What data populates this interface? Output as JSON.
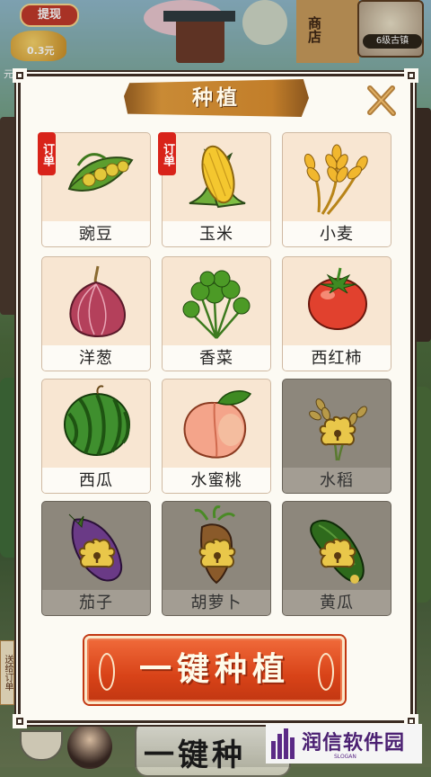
{
  "hud": {
    "withdraw_label": "提现",
    "coin_amount": "0.3元",
    "cut_text": "元",
    "shop_sign": "商店",
    "ancient_town_label": "6级古镇",
    "side_tag": "送给订单"
  },
  "dialog": {
    "title": "种植",
    "crops": [
      {
        "name": "豌豆",
        "order_tag": "订单",
        "locked": false,
        "icon": "pea-pod-icon"
      },
      {
        "name": "玉米",
        "order_tag": "订单",
        "locked": false,
        "icon": "corn-icon"
      },
      {
        "name": "小麦",
        "order_tag": "",
        "locked": false,
        "icon": "wheat-icon"
      },
      {
        "name": "洋葱",
        "order_tag": "",
        "locked": false,
        "icon": "onion-icon"
      },
      {
        "name": "香菜",
        "order_tag": "",
        "locked": false,
        "icon": "cilantro-icon"
      },
      {
        "name": "西红柿",
        "order_tag": "",
        "locked": false,
        "icon": "tomato-icon"
      },
      {
        "name": "西瓜",
        "order_tag": "",
        "locked": false,
        "icon": "watermelon-icon"
      },
      {
        "name": "水蜜桃",
        "order_tag": "",
        "locked": false,
        "icon": "peach-icon"
      },
      {
        "name": "水稻",
        "order_tag": "",
        "locked": true,
        "icon": "rice-icon"
      },
      {
        "name": "茄子",
        "order_tag": "",
        "locked": true,
        "icon": "eggplant-icon"
      },
      {
        "name": "胡萝卜",
        "order_tag": "",
        "locked": true,
        "icon": "carrot-icon"
      },
      {
        "name": "黄瓜",
        "order_tag": "",
        "locked": true,
        "icon": "cucumber-icon"
      }
    ],
    "plant_all_label": "一键种植"
  },
  "background_button_text": "一键种",
  "watermark": {
    "name": "润信软件园",
    "slogan": "SLOGAN"
  },
  "colors": {
    "accent": "#d84318",
    "order_tag": "#d8231a",
    "banner": "#c27e2a",
    "locked_card": "#8d877c",
    "card": "#f8e6d2"
  }
}
